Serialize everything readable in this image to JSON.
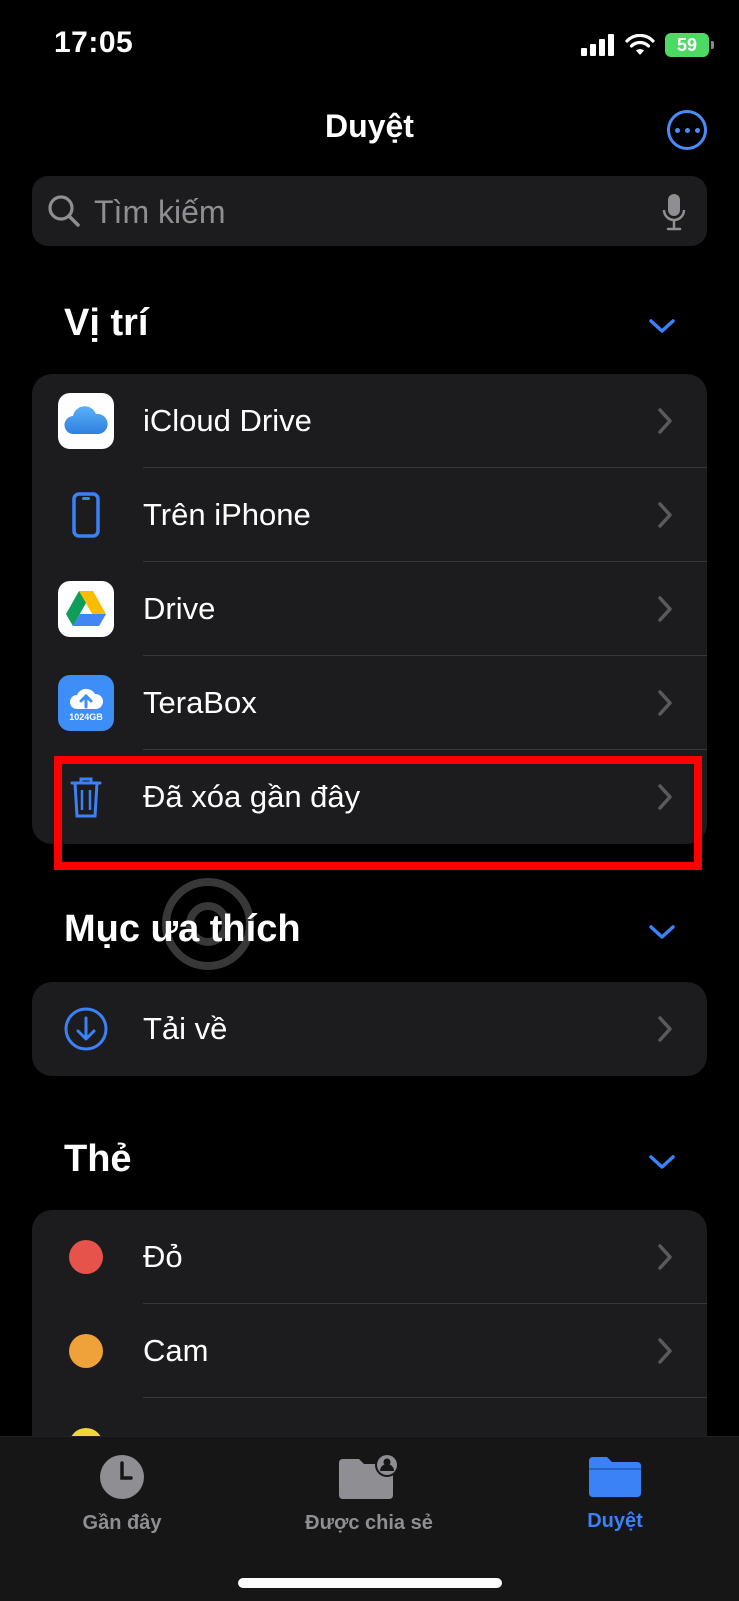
{
  "status": {
    "time": "17:05",
    "battery": "59"
  },
  "nav": {
    "title": "Duyệt"
  },
  "search": {
    "placeholder": "Tìm kiếm"
  },
  "sections": {
    "locations": {
      "title": "Vị trí",
      "items": [
        {
          "label": "iCloud Drive",
          "icon": "icloud-icon"
        },
        {
          "label": "Trên iPhone",
          "icon": "iphone-icon"
        },
        {
          "label": "Drive",
          "icon": "google-drive-icon"
        },
        {
          "label": "TeraBox",
          "icon": "terabox-icon",
          "badge": "1024GB"
        },
        {
          "label": "Đã xóa gần đây",
          "icon": "trash-icon"
        }
      ]
    },
    "favorites": {
      "title": "Mục ưa thích",
      "items": [
        {
          "label": "Tải về",
          "icon": "download-icon"
        }
      ]
    },
    "tags": {
      "title": "Thẻ",
      "items": [
        {
          "label": "Đỏ",
          "color": "#e5534b"
        },
        {
          "label": "Cam",
          "color": "#f0a23a"
        },
        {
          "label": "",
          "color": "#f2d53c"
        }
      ]
    }
  },
  "watermark": "@uantrimang",
  "tabs": [
    {
      "label": "Gần đây",
      "icon": "clock-icon"
    },
    {
      "label": "Được chia sẻ",
      "icon": "shared-folder-icon"
    },
    {
      "label": "Duyệt",
      "icon": "folder-icon",
      "active": true
    }
  ],
  "colors": {
    "accent": "#3b82f6",
    "highlight": "#ff0000"
  }
}
